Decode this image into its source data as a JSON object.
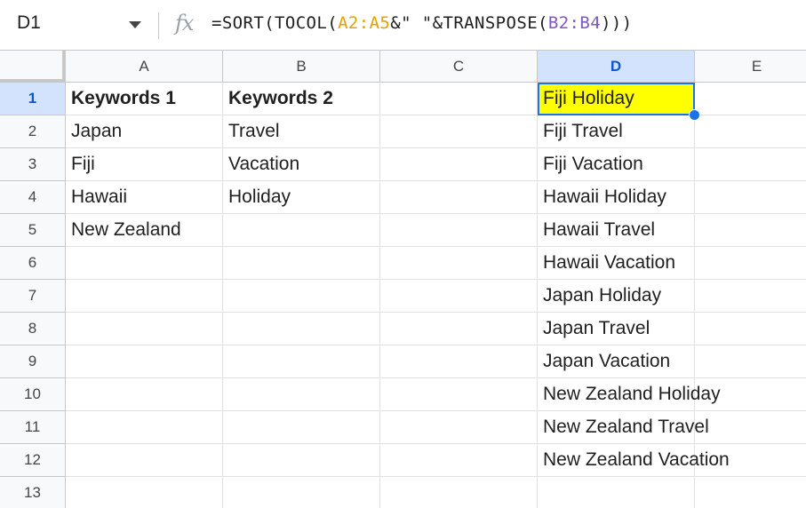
{
  "formula_bar": {
    "name_box": "D1",
    "fx_label": "fx",
    "formula_parts": [
      "=SORT(TOCOL(",
      "A2:A5",
      "&\" \"&TRANSPOSE(",
      "B2:B4",
      ")))"
    ]
  },
  "colors": {
    "selection": "#1a73e8",
    "highlight_fill": "#ffff00",
    "ref_a": "#e8a000",
    "ref_b": "#7e57c2"
  },
  "columns": [
    "A",
    "B",
    "C",
    "D",
    "E"
  ],
  "active_column": "D",
  "active_row": "1",
  "rows": [
    {
      "num": "1",
      "A": "Keywords 1",
      "B": "Keywords 2",
      "D": "Fiji Holiday"
    },
    {
      "num": "2",
      "A": "Japan",
      "B": "Travel",
      "D": "Fiji Travel"
    },
    {
      "num": "3",
      "A": "Fiji",
      "B": "Vacation",
      "D": "Fiji Vacation"
    },
    {
      "num": "4",
      "A": "Hawaii",
      "B": "Holiday",
      "D": "Hawaii Holiday"
    },
    {
      "num": "5",
      "A": "New Zealand",
      "B": "",
      "D": "Hawaii Travel"
    },
    {
      "num": "6",
      "A": "",
      "B": "",
      "D": "Hawaii Vacation"
    },
    {
      "num": "7",
      "A": "",
      "B": "",
      "D": "Japan Holiday"
    },
    {
      "num": "8",
      "A": "",
      "B": "",
      "D": "Japan Travel"
    },
    {
      "num": "9",
      "A": "",
      "B": "",
      "D": "Japan Vacation"
    },
    {
      "num": "10",
      "A": "",
      "B": "",
      "D": "New Zealand Holiday"
    },
    {
      "num": "11",
      "A": "",
      "B": "",
      "D": "New Zealand Travel"
    },
    {
      "num": "12",
      "A": "",
      "B": "",
      "D": "New Zealand Vacation"
    },
    {
      "num": "13",
      "A": "",
      "B": "",
      "D": ""
    }
  ]
}
